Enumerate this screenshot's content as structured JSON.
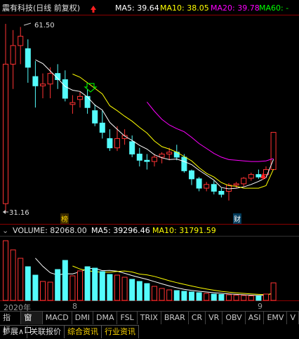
{
  "header": {
    "title": "震有科技(日线 前复权)",
    "ma5": "MA5: 39.64",
    "ma10": "MA10: 38.05",
    "ma20": "MA20: 39.78",
    "ma60": "MA60: -"
  },
  "price_labels": {
    "high": "61.50",
    "low": "31.16"
  },
  "markers": {
    "bang": "榜",
    "cai": "财"
  },
  "volume_header": {
    "volume": "VOLUME: 82068.00",
    "ma5": "MA5: 39296.46",
    "ma10": "MA10: 31791.59"
  },
  "date_axis": {
    "year": "2020年",
    "month1": "8",
    "month2": "9"
  },
  "indicator_tabs": [
    "指标",
    "窗口",
    "MACD",
    "DMI",
    "DMA",
    "FSL",
    "TRIX",
    "BRAR",
    "CR",
    "VR",
    "OBV",
    "ASI",
    "EMV",
    "V"
  ],
  "bottom_tabs": [
    "扩展∧",
    "关联报价",
    "综合资讯",
    "行业资讯"
  ],
  "colors": {
    "up": "#ff3333",
    "down": "#54fcfc",
    "ma5": "#ffffff",
    "ma10": "#ffff00",
    "ma20": "#ff00ff",
    "ma60": "#00ff00"
  },
  "chart_data": {
    "type": "candlestick",
    "price_range": [
      31.16,
      61.5
    ],
    "candles": [
      {
        "o": 32.5,
        "h": 61.5,
        "l": 31.2,
        "c": 55.0,
        "v": 85000
      },
      {
        "o": 55.0,
        "h": 60.5,
        "l": 51.0,
        "c": 58.0,
        "v": 72000
      },
      {
        "o": 58.0,
        "h": 61.0,
        "l": 55.0,
        "c": 59.5,
        "v": 60000
      },
      {
        "o": 57.5,
        "h": 59.0,
        "l": 52.0,
        "c": 54.5,
        "v": 48000
      },
      {
        "o": 53.0,
        "h": 55.5,
        "l": 48.0,
        "c": 51.5,
        "v": 36000
      },
      {
        "o": 51.5,
        "h": 53.5,
        "l": 49.5,
        "c": 51.8,
        "v": 27000
      },
      {
        "o": 51.8,
        "h": 54.5,
        "l": 49.5,
        "c": 53.5,
        "v": 26000
      },
      {
        "o": 53.5,
        "h": 55.0,
        "l": 51.0,
        "c": 52.5,
        "v": 44000
      },
      {
        "o": 52.5,
        "h": 54.0,
        "l": 49.0,
        "c": 49.5,
        "v": 57000
      },
      {
        "o": 48.5,
        "h": 50.0,
        "l": 47.0,
        "c": 48.8,
        "v": 35000
      },
      {
        "o": 49.3,
        "h": 50.5,
        "l": 48.0,
        "c": 49.8,
        "v": 42000
      },
      {
        "o": 49.8,
        "h": 51.0,
        "l": 47.0,
        "c": 48.0,
        "v": 48000
      },
      {
        "o": 47.5,
        "h": 48.5,
        "l": 45.0,
        "c": 45.5,
        "v": 46000
      },
      {
        "o": 45.5,
        "h": 47.5,
        "l": 43.0,
        "c": 44.0,
        "v": 41000
      },
      {
        "o": 43.0,
        "h": 44.5,
        "l": 41.0,
        "c": 41.5,
        "v": 37000
      },
      {
        "o": 41.5,
        "h": 45.0,
        "l": 41.0,
        "c": 43.0,
        "v": 36000
      },
      {
        "o": 43.0,
        "h": 44.5,
        "l": 42.0,
        "c": 43.5,
        "v": 33000
      },
      {
        "o": 42.5,
        "h": 43.5,
        "l": 40.0,
        "c": 40.5,
        "v": 30000
      },
      {
        "o": 40.5,
        "h": 41.5,
        "l": 38.5,
        "c": 39.5,
        "v": 27000
      },
      {
        "o": 39.5,
        "h": 40.5,
        "l": 38.0,
        "c": 39.3,
        "v": 24000
      },
      {
        "o": 39.3,
        "h": 40.5,
        "l": 38.5,
        "c": 40.0,
        "v": 20000
      },
      {
        "o": 40.0,
        "h": 40.8,
        "l": 39.0,
        "c": 40.5,
        "v": 17000
      },
      {
        "o": 40.5,
        "h": 41.5,
        "l": 39.5,
        "c": 40.8,
        "v": 15000
      },
      {
        "o": 40.8,
        "h": 42.0,
        "l": 39.5,
        "c": 40.0,
        "v": 14000
      },
      {
        "o": 40.0,
        "h": 40.5,
        "l": 37.5,
        "c": 37.8,
        "v": 13000
      },
      {
        "o": 37.8,
        "h": 38.0,
        "l": 35.5,
        "c": 36.5,
        "v": 12000
      },
      {
        "o": 36.5,
        "h": 36.8,
        "l": 34.5,
        "c": 35.0,
        "v": 11000
      },
      {
        "o": 35.0,
        "h": 36.0,
        "l": 34.5,
        "c": 35.6,
        "v": 10000
      },
      {
        "o": 35.6,
        "h": 36.2,
        "l": 34.0,
        "c": 34.5,
        "v": 9000
      },
      {
        "o": 34.5,
        "h": 35.0,
        "l": 33.5,
        "c": 34.0,
        "v": 8500
      },
      {
        "o": 34.5,
        "h": 35.8,
        "l": 33.0,
        "c": 35.5,
        "v": 8000
      },
      {
        "o": 35.5,
        "h": 36.0,
        "l": 35.0,
        "c": 35.7,
        "v": 7500
      },
      {
        "o": 35.7,
        "h": 36.8,
        "l": 35.3,
        "c": 36.6,
        "v": 7000
      },
      {
        "o": 36.6,
        "h": 37.5,
        "l": 36.2,
        "c": 37.2,
        "v": 6500
      },
      {
        "o": 37.2,
        "h": 38.0,
        "l": 36.5,
        "c": 36.8,
        "v": 6000
      },
      {
        "o": 37.2,
        "h": 38.5,
        "l": 37.0,
        "c": 38.0,
        "v": 9000
      },
      {
        "o": 38.0,
        "h": 44.0,
        "l": 38.0,
        "c": 44.0,
        "v": 25000
      }
    ],
    "ma5_line": [
      null,
      null,
      null,
      null,
      55.7,
      55.1,
      53.9,
      52.7,
      51.4,
      50.8,
      50.6,
      49.7,
      48.4,
      47.6,
      45.6,
      44.5,
      43.4,
      42.7,
      41.9,
      41.3,
      40.4,
      39.9,
      39.6,
      39.7,
      39.3,
      38.8,
      37.9,
      37.1,
      36.3,
      35.1,
      34.9,
      35.0,
      35.2,
      35.6,
      36.1,
      36.7,
      39.64
    ],
    "ma10_line": [
      null,
      null,
      null,
      null,
      null,
      null,
      null,
      null,
      null,
      53.4,
      52.9,
      52.0,
      51.1,
      50.2,
      48.3,
      47.5,
      46.6,
      45.8,
      44.8,
      43.9,
      42.6,
      41.7,
      41.3,
      40.8,
      40.1,
      39.4,
      38.3,
      37.4,
      36.8,
      35.9,
      35.4,
      35.3,
      35.0,
      35.0,
      35.0,
      35.4,
      38.05
    ],
    "ma20_line": [
      null,
      null,
      null,
      null,
      null,
      null,
      null,
      null,
      null,
      null,
      null,
      null,
      null,
      null,
      null,
      null,
      null,
      null,
      null,
      48.9,
      47.4,
      46.1,
      45.2,
      44.6,
      44.1,
      43.2,
      42.2,
      41.4,
      40.6,
      40.0,
      39.6,
      39.5,
      39.4,
      39.3,
      39.3,
      39.4,
      39.78
    ]
  }
}
